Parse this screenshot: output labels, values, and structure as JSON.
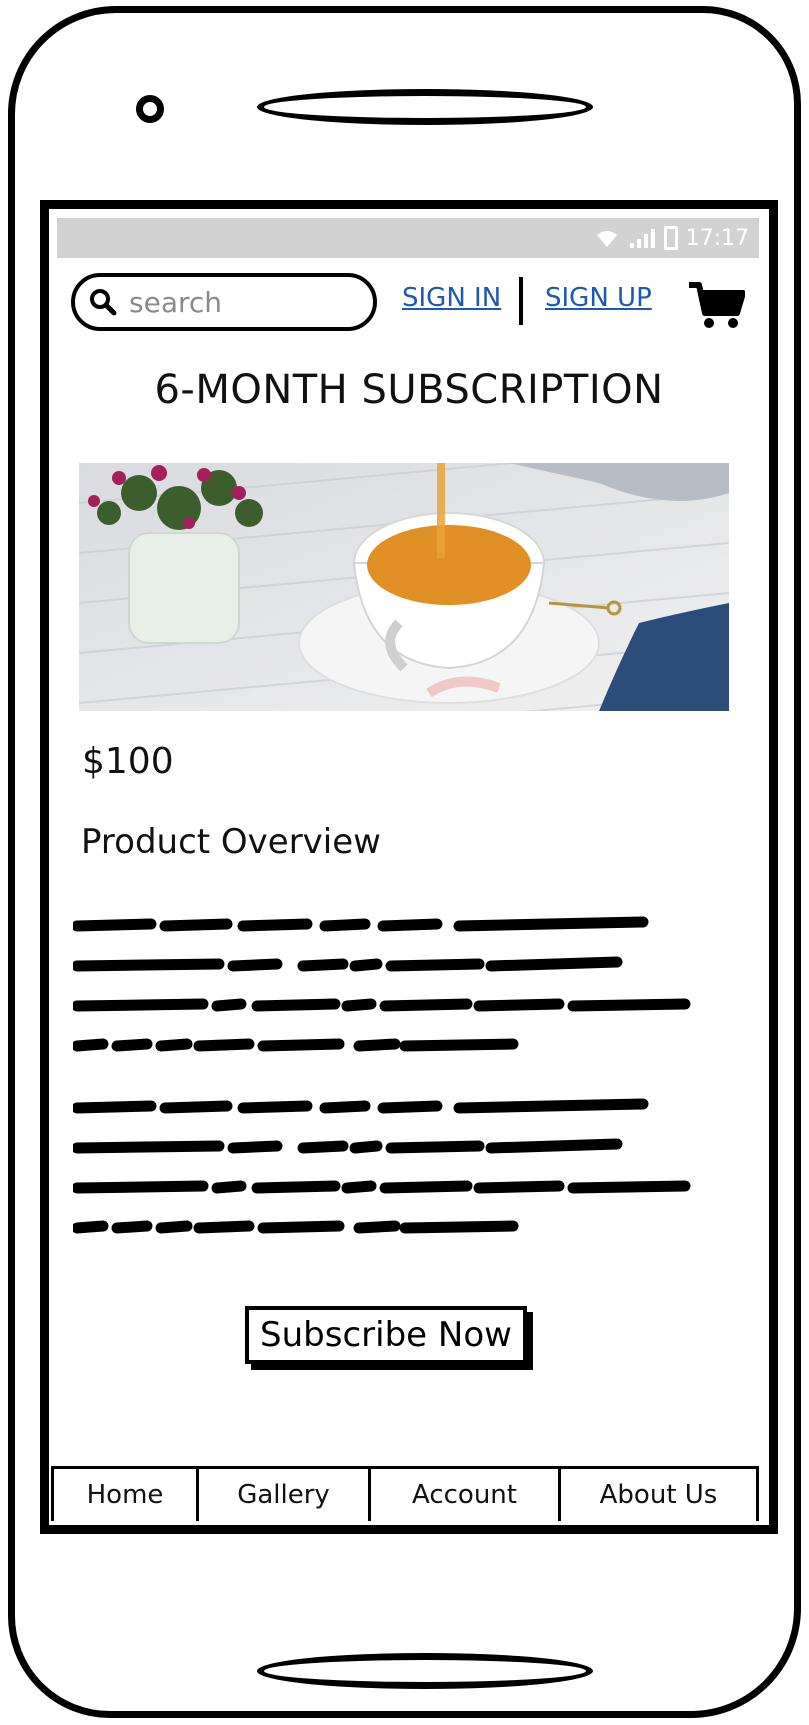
{
  "status": {
    "time": "17:17"
  },
  "header": {
    "search_placeholder": "search",
    "sign_in": "SIGN IN",
    "sign_up": "SIGN UP",
    "cart_icon": "cart-icon",
    "search_icon": "search-icon"
  },
  "product": {
    "title": "6-MONTH SUBSCRIPTION",
    "price": "$100",
    "overview_heading": "Product Overview",
    "cta": "Subscribe Now"
  },
  "tabs": [
    "Home",
    "Gallery",
    "Account",
    "About Us"
  ],
  "colors": {
    "link": "#1d58b7",
    "statusbar": "#d2d2d2"
  }
}
